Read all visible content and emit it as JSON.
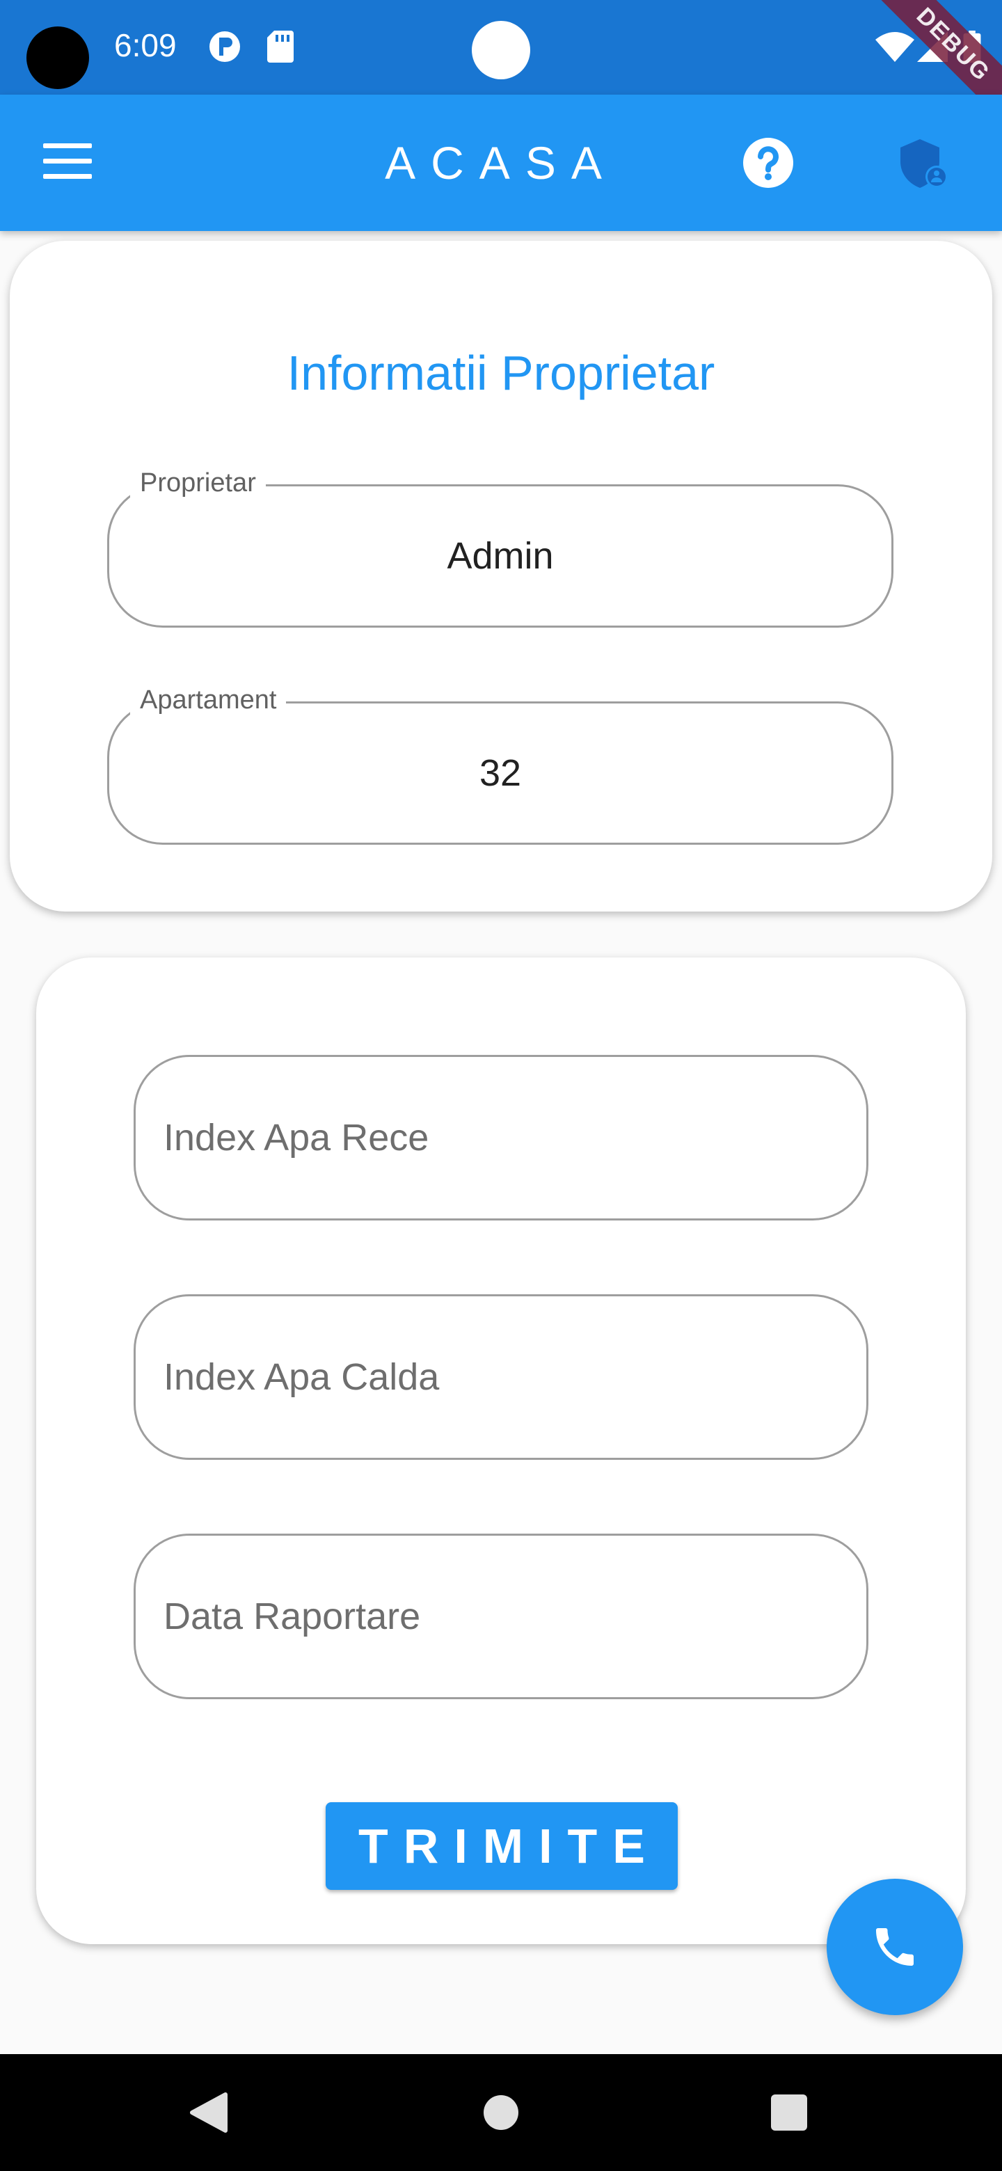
{
  "status_bar": {
    "time": "6:09",
    "debug_banner": "DEBUG",
    "icons": [
      "notification-p-icon",
      "sd-card-icon",
      "wifi-icon",
      "signal-icon",
      "battery-icon"
    ]
  },
  "app_bar": {
    "title": "ACASA",
    "icons": [
      "menu-icon",
      "help-icon",
      "admin-shield-icon"
    ],
    "background": "#2196f3"
  },
  "owner_card": {
    "title": "Informatii Proprietar",
    "owner_field": {
      "label": "Proprietar",
      "value": "Admin"
    },
    "apartment_field": {
      "label": "Apartament",
      "value": "32"
    }
  },
  "report_form": {
    "cold_water": {
      "placeholder": "Index Apa Rece",
      "value": ""
    },
    "hot_water": {
      "placeholder": "Index Apa Calda",
      "value": ""
    },
    "report_date": {
      "placeholder": "Data Raportare",
      "value": ""
    },
    "submit_label": "TRIMITE"
  },
  "fab": {
    "icon": "phone-icon"
  },
  "nav_bar": {
    "icons": [
      "back-icon",
      "home-icon",
      "recents-icon"
    ]
  },
  "colors": {
    "primary": "#2196f3",
    "status_bar": "#1976d2",
    "background": "#fafafa"
  }
}
